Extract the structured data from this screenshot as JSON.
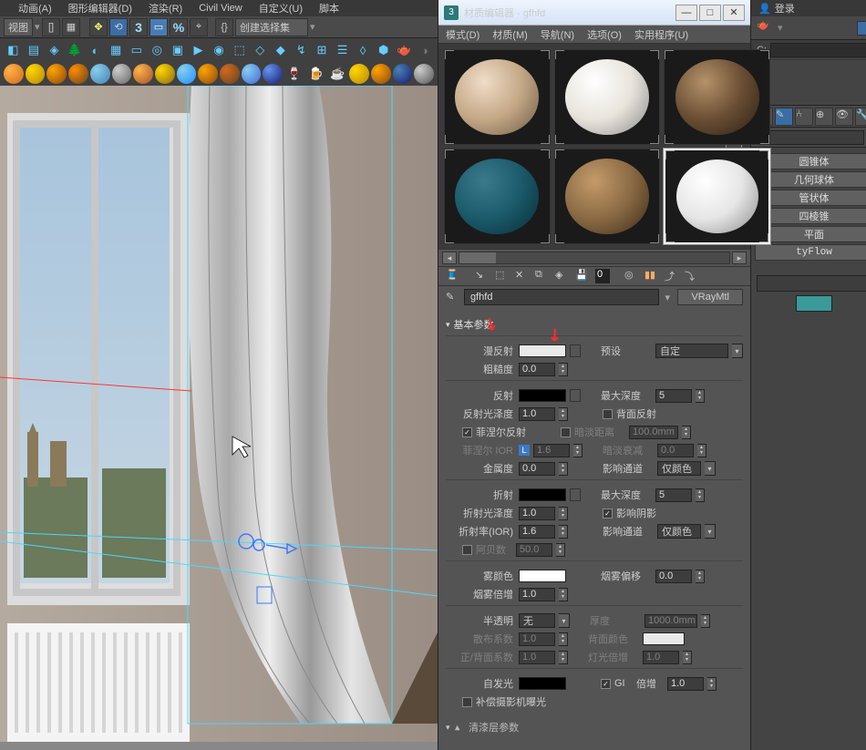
{
  "topmenu": {
    "anim": "动画(A)",
    "gfxedit": "图形编辑器(D)",
    "render": "渲染(R)",
    "civil": "Civil View",
    "custom": "自定义(U)",
    "script": "脚本"
  },
  "toolbar": {
    "viewlabel": "视图",
    "createset": "创建选择集"
  },
  "matwin": {
    "title": "材质编辑器 - gfhfd",
    "menus": {
      "mode": "模式(D)",
      "material": "材质(M)",
      "nav": "导航(N)",
      "options": "选项(O)",
      "utils": "实用程序(U)"
    },
    "matname": "gfhfd",
    "mattype": "VRayMtl",
    "section": "基本参数",
    "labels": {
      "diffuse": "漫反射",
      "roughness": "粗糙度",
      "preset": "预设",
      "preset_val": "自定",
      "reflect": "反射",
      "rglossy": "反射光泽度",
      "maxdepth": "最大深度",
      "backrefl": "背面反射",
      "fresnel": "菲涅尔反射",
      "fresnelior": "菲涅尔 IOR",
      "dimdist": "暗淡距离",
      "dimfall": "暗淡衰减",
      "metalness": "金属度",
      "affectch": "影响通道",
      "coloronly": "仅颜色",
      "refract": "折射",
      "refrglossy": "折射光泽度",
      "affectshadow": "影响阴影",
      "ior": "折射率(IOR)",
      "abbe": "阿贝数",
      "fog": "雾颜色",
      "fogbias": "烟雾偏移",
      "fogmult": "烟雾倍增",
      "trans": "半透明",
      "none": "无",
      "thick": "厚度",
      "backcolor": "背面颜色",
      "scatter": "散布系数",
      "lightmult": "灯光倍增",
      "frontback": "正/背面系数",
      "selfillum": "自发光",
      "gi": "GI",
      "mult": "倍增",
      "compensate": "补偿摄影机曝光",
      "coat": "清漆层参数"
    },
    "vals": {
      "roughness": "0.0",
      "rglossy": "1.0",
      "maxdepth": "5",
      "fresnelior": "1.6",
      "dimdist": "100.0mm",
      "dimfall": "0.0",
      "metalness": "0.0",
      "refrglossy": "1.0",
      "refrmaxdepth": "5",
      "ior": "1.6",
      "abbe": "50.0",
      "fogbias": "0.0",
      "fogmult": "1.0",
      "thick": "1000.0mm",
      "scatter": "1.0",
      "lightmult": "1.0",
      "frontback": "1.0",
      "selfmult": "1.0"
    }
  },
  "right": {
    "login": "登录",
    "items": [
      "圆锥体",
      "几何球体",
      "管状体",
      "四棱锥",
      "平面",
      "tyFlow"
    ]
  }
}
